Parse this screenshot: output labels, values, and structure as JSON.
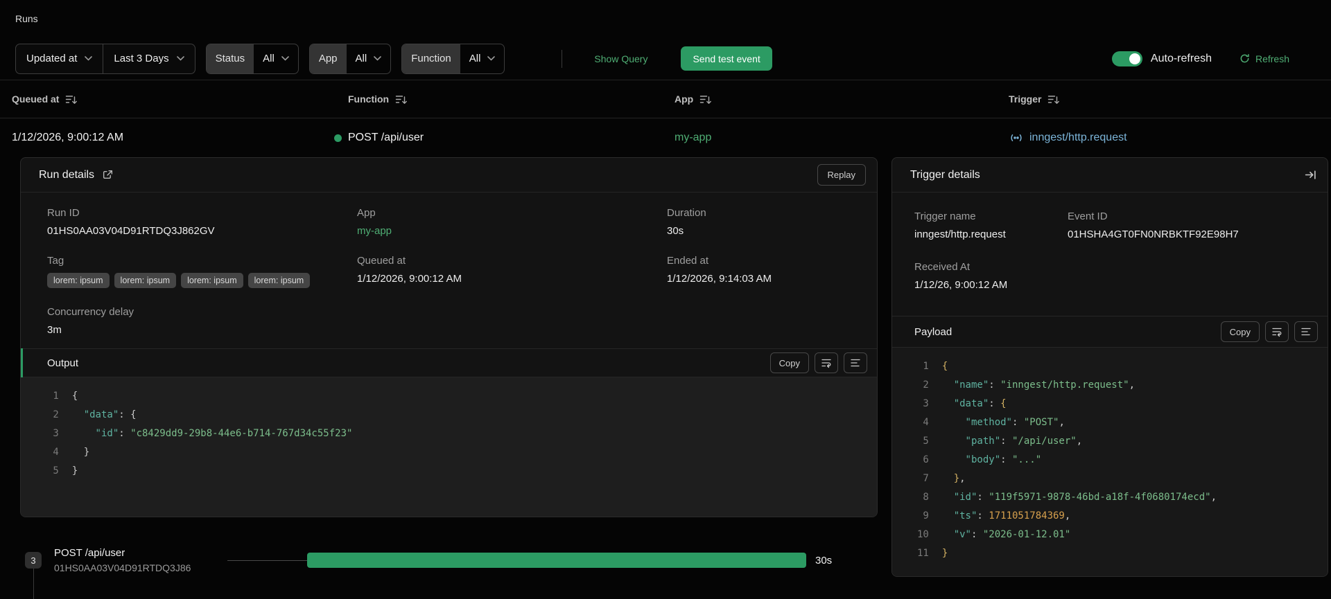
{
  "page": {
    "title": "Runs"
  },
  "filters": {
    "sort_field": "Updated at",
    "time_range": "Last 3 Days",
    "status_label": "Status",
    "status_value": "All",
    "app_label": "App",
    "app_value": "All",
    "function_label": "Function",
    "function_value": "All",
    "show_query": "Show Query",
    "send_test_event": "Send test event",
    "auto_refresh_label": "Auto-refresh",
    "refresh_label": "Refresh"
  },
  "runs_table": {
    "headers": {
      "queued_at": "Queued at",
      "function": "Function",
      "app": "App",
      "trigger": "Trigger"
    },
    "row": {
      "queued_at": "1/12/2026, 9:00:12 AM",
      "function": "POST /api/user",
      "app": "my-app",
      "trigger": "inngest/http.request"
    }
  },
  "run_details": {
    "title": "Run details",
    "replay_button": "Replay",
    "run_id_label": "Run ID",
    "run_id": "01HS0AA03V04D91RTDQ3J862GV",
    "app_label": "App",
    "app": "my-app",
    "duration_label": "Duration",
    "duration": "30s",
    "tag_label": "Tag",
    "tags": [
      "lorem: ipsum",
      "lorem: ipsum",
      "lorem: ipsum",
      "lorem: ipsum"
    ],
    "queued_at_label": "Queued at",
    "queued_at": "1/12/2026, 9:00:12 AM",
    "ended_at_label": "Ended at",
    "ended_at": "1/12/2026, 9:14:03 AM",
    "concurrency_label": "Concurrency delay",
    "concurrency": "3m"
  },
  "output": {
    "title": "Output",
    "copy_button": "Copy",
    "code": [
      [
        [
          "pu",
          "{"
        ]
      ],
      [
        [
          "k",
          "  \"data\""
        ],
        [
          "pu",
          ": {"
        ]
      ],
      [
        [
          "k",
          "    \"id\""
        ],
        [
          "pu",
          ": "
        ],
        [
          "s",
          "\"c8429dd9-29b8-44e6-b714-767d34c55f23\""
        ]
      ],
      [
        [
          "pu",
          "  }"
        ]
      ],
      [
        [
          "pu",
          "}"
        ]
      ]
    ]
  },
  "trigger_details": {
    "title": "Trigger details",
    "trigger_name_label": "Trigger name",
    "trigger_name": "inngest/http.request",
    "event_id_label": "Event ID",
    "event_id": "01HSHA4GT0FN0NRBKTF92E98H7",
    "received_at_label": "Received At",
    "received_at": "1/12/26, 9:00:12 AM",
    "payload": {
      "title": "Payload",
      "copy_button": "Copy",
      "code": [
        [
          [
            "br",
            "{"
          ]
        ],
        [
          [
            "k",
            "  \"name\""
          ],
          [
            "pu",
            ": "
          ],
          [
            "s",
            "\"inngest/http.request\""
          ],
          [
            "pu",
            ","
          ]
        ],
        [
          [
            "k",
            "  \"data\""
          ],
          [
            "pu",
            ": "
          ],
          [
            "br",
            "{"
          ]
        ],
        [
          [
            "k",
            "    \"method\""
          ],
          [
            "pu",
            ": "
          ],
          [
            "s",
            "\"POST\""
          ],
          [
            "pu",
            ","
          ]
        ],
        [
          [
            "k",
            "    \"path\""
          ],
          [
            "pu",
            ": "
          ],
          [
            "s",
            "\"/api/user\""
          ],
          [
            "pu",
            ","
          ]
        ],
        [
          [
            "k",
            "    \"body\""
          ],
          [
            "pu",
            ": "
          ],
          [
            "s",
            "\"...\""
          ]
        ],
        [
          [
            "br",
            "  }"
          ],
          [
            "pu",
            ","
          ]
        ],
        [
          [
            "k",
            "  \"id\""
          ],
          [
            "pu",
            ": "
          ],
          [
            "s",
            "\"119f5971-9878-46bd-a18f-4f0680174ecd\""
          ],
          [
            "pu",
            ","
          ]
        ],
        [
          [
            "k",
            "  \"ts\""
          ],
          [
            "pu",
            ": "
          ],
          [
            "n",
            "1711051784369"
          ],
          [
            "pu",
            ","
          ]
        ],
        [
          [
            "k",
            "  \"v\""
          ],
          [
            "pu",
            ": "
          ],
          [
            "s",
            "\"2026-01-12.01\""
          ]
        ],
        [
          [
            "br",
            "}"
          ]
        ]
      ]
    }
  },
  "timeline": {
    "step_count": "3",
    "step_name": "POST /api/user",
    "step_id": "01HS0AA03V04D91RTDQ3J86",
    "duration": "30s"
  },
  "colors": {
    "accent_green": "#2c9b63",
    "link_green": "#4fae74",
    "trigger_blue": "#7cb5d9",
    "key_teal": "#5fb3a1",
    "string_green": "#7cbd8b",
    "number_orange": "#d7a04d"
  }
}
